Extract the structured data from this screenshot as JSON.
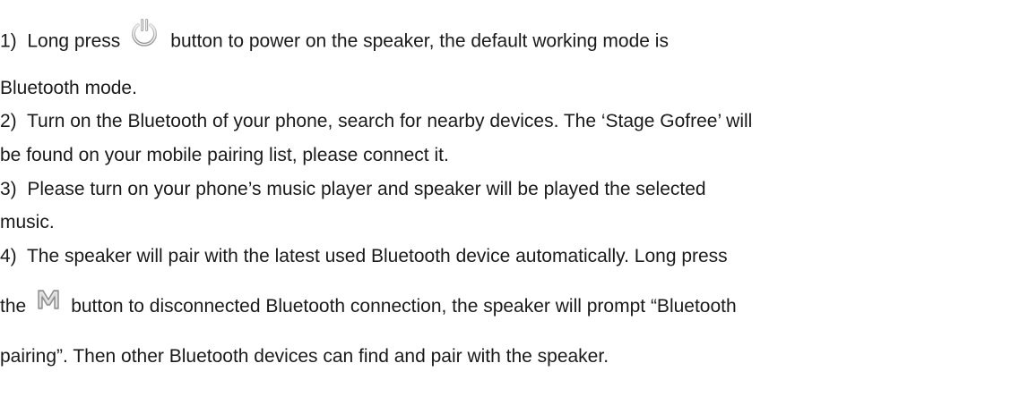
{
  "instructions": [
    {
      "number": "1)",
      "lines": [
        {
          "before": "Long press",
          "after": "button to power on the speaker, the default working mode is",
          "icon": "power-icon"
        },
        {
          "text": "Bluetooth mode."
        }
      ]
    },
    {
      "number": "2)",
      "lines": [
        {
          "text": "Turn on the Bluetooth of your phone, search for nearby devices. The ‘Stage Gofree’ will"
        },
        {
          "text": "be found on your mobile pairing list, please connect it."
        }
      ]
    },
    {
      "number": "3)",
      "lines": [
        {
          "text": "Please turn on your phone’s music player and speaker will be played the selected"
        },
        {
          "text": "music."
        }
      ]
    },
    {
      "number": "4)",
      "lines": [
        {
          "text": "The speaker will pair with the latest used Bluetooth device automatically. Long press"
        },
        {
          "before": "the",
          "after": "button to disconnected Bluetooth connection, the speaker will prompt “Bluetooth",
          "icon": "m-mode-icon"
        },
        {
          "text": "pairing”. Then other Bluetooth devices can find and pair with the speaker."
        }
      ]
    }
  ]
}
